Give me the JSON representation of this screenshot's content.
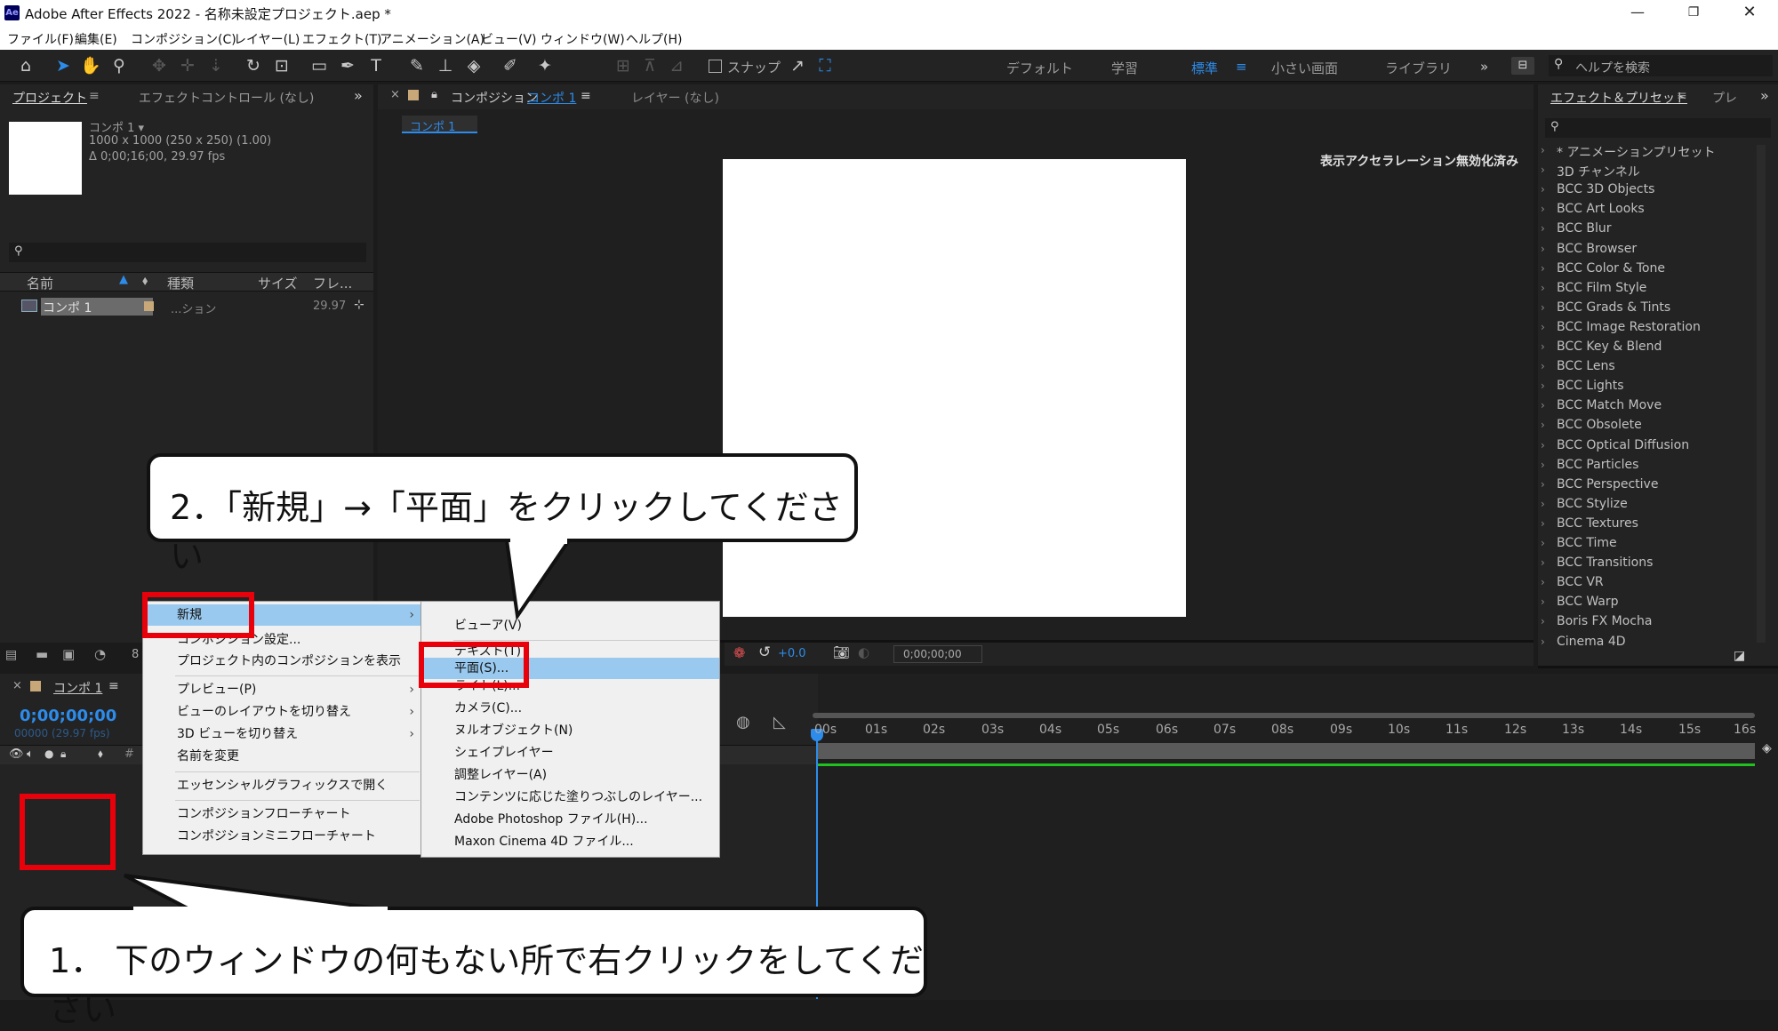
{
  "titlebar": {
    "title": "Adobe After Effects 2022 - 名称未設定プロジェクト.aep *",
    "app_icon": "Ae"
  },
  "menubar": [
    "ファイル(F)",
    "編集(E)",
    "コンポジション(C)",
    "レイヤー(L)",
    "エフェクト(T)",
    "アニメーション(A)",
    "ビュー(V)",
    "ウィンドウ(W)",
    "ヘルプ(H)"
  ],
  "toolbar": {
    "snap_label": "スナップ",
    "workspaces": [
      "デフォルト",
      "学習",
      "標準",
      "小さい画面",
      "ライブラリ"
    ],
    "active_workspace": "標準",
    "help_search_placeholder": "ヘルプを検索"
  },
  "project_panel": {
    "tab_project": "プロジェクト",
    "tab_effect_controls": "エフェクトコントロール (なし)",
    "comp_name": "コンポ 1 ▾",
    "comp_size": "1000 x 1000  (250 x 250) (1.00)",
    "comp_duration": "Δ 0;00;16;00, 29.97 fps",
    "columns": [
      "名前",
      "種類",
      "サイズ",
      "フレ..."
    ],
    "row": {
      "name": "コンポ 1",
      "type": "...ション",
      "fps": "29.97"
    }
  },
  "comp_panel": {
    "tab_prefix": "コンポジション",
    "tab_comp": "コンポ 1",
    "tab_layer": "レイヤー (なし)",
    "breadcrumb": "コンポ 1",
    "notice": "表示アクセラレーション無効化済み",
    "plus": "+0.0",
    "timecode": "0;00;00;00",
    "zoom_prefix": "8"
  },
  "effects_panel": {
    "tab": "エフェクト＆プリセット",
    "tab2": "プレ",
    "items": [
      "* アニメーションプリセット",
      "3D チャンネル",
      "BCC 3D Objects",
      "BCC Art Looks",
      "BCC Blur",
      "BCC Browser",
      "BCC Color & Tone",
      "BCC Film Style",
      "BCC Grads & Tints",
      "BCC Image Restoration",
      "BCC Key & Blend",
      "BCC Lens",
      "BCC Lights",
      "BCC Match Move",
      "BCC Obsolete",
      "BCC Optical Diffusion",
      "BCC Particles",
      "BCC Perspective",
      "BCC Stylize",
      "BCC Textures",
      "BCC Time",
      "BCC Transitions",
      "BCC VR",
      "BCC Warp",
      "Boris FX Mocha",
      "Cinema 4D"
    ]
  },
  "timeline": {
    "tab": "コンポ 1",
    "timecode": "0;00;00;00",
    "frames": "00000 (29.97 fps)",
    "ticks": [
      "00s",
      "01s",
      "02s",
      "03s",
      "04s",
      "05s",
      "06s",
      "07s",
      "08s",
      "09s",
      "10s",
      "11s",
      "12s",
      "13s",
      "14s",
      "15s",
      "16s"
    ]
  },
  "context_menu": {
    "items": [
      "新規",
      "コンポジション設定...",
      "プロジェクト内のコンポジションを表示",
      "プレビュー(P)",
      "ビューのレイアウトを切り替え",
      "3D ビューを切り替え",
      "名前を変更",
      "エッセンシャルグラフィックスで開く",
      "コンポジションフローチャート",
      "コンポジションミニフローチャート"
    ]
  },
  "submenu": {
    "items": [
      "ビューア(V)",
      "テキスト(T)",
      "平面(S)...",
      "ライト(L)...",
      "カメラ(C)...",
      "ヌルオブジェクト(N)",
      "シェイプレイヤー",
      "調整レイヤー(A)",
      "コンテンツに応じた塗りつぶしのレイヤー...",
      "Adobe Photoshop ファイル(H)...",
      "Maxon Cinema 4D ファイル..."
    ]
  },
  "callouts": {
    "step1": "1． 下のウィンドウの何もない所で右クリックをしてください",
    "step2": "2．「新規」→「平面」をクリックしてください"
  },
  "colors": {
    "accent": "#2d8ceb",
    "highlight": "#99c9ef",
    "red": "#e8000b",
    "green": "#1fc21f"
  }
}
